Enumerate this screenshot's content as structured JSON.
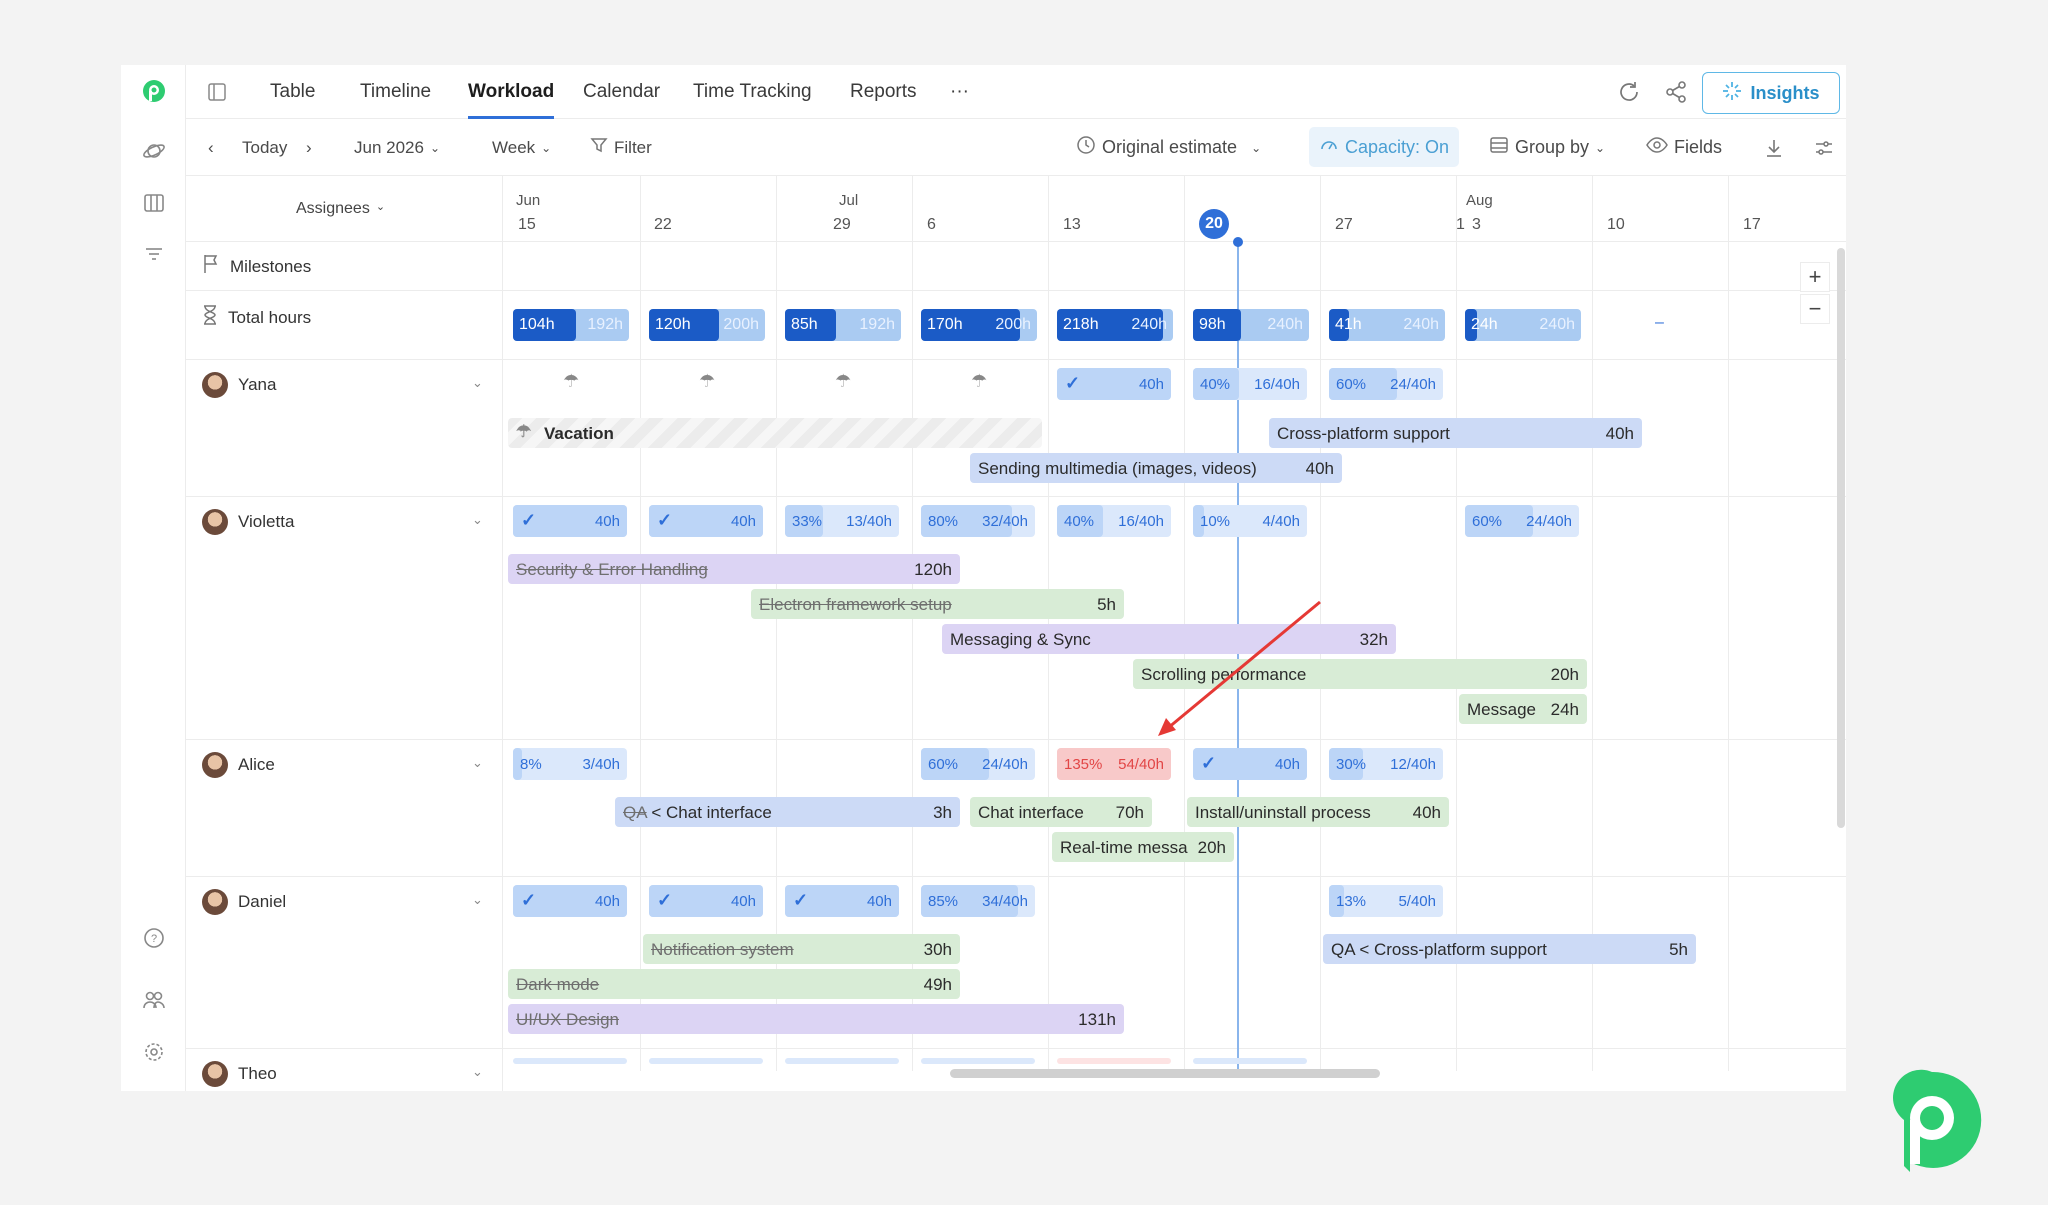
{
  "nav": {
    "tabs": [
      "Table",
      "Timeline",
      "Workload",
      "Calendar",
      "Time Tracking",
      "Reports",
      "···"
    ],
    "insights_label": "Insights"
  },
  "toolbar": {
    "today": "Today",
    "month": "Jun 2026",
    "period": "Week",
    "filter": "Filter",
    "estimate": "Original estimate",
    "capacity": "Capacity: On",
    "group_by": "Group by",
    "fields": "Fields"
  },
  "timeline": {
    "assignees_label": "Assignees",
    "months": [
      "Jun",
      "Jul",
      "Aug"
    ],
    "days": [
      "15",
      "22",
      "29",
      "6",
      "13",
      "20",
      "27",
      "1",
      "3",
      "10",
      "17"
    ],
    "today_day": "20"
  },
  "rows": {
    "milestones": "Milestones",
    "total_hours": "Total hours",
    "people": [
      "Yana",
      "Violetta",
      "Alice",
      "Daniel",
      "Theo"
    ]
  },
  "total_hours": [
    {
      "used": "104h",
      "cap": "192h"
    },
    {
      "used": "120h",
      "cap": "200h"
    },
    {
      "used": "85h",
      "cap": "192h"
    },
    {
      "used": "170h",
      "cap": "200h"
    },
    {
      "used": "218h",
      "cap": "240h"
    },
    {
      "used": "98h",
      "cap": "240h"
    },
    {
      "used": "41h",
      "cap": "240h"
    },
    {
      "used": "24h",
      "cap": "240h"
    },
    {
      "used": "–"
    }
  ],
  "capacity_cells": {
    "yana": [
      {
        "h": "40h"
      },
      {
        "p": "40%",
        "h": "16/40h"
      },
      {
        "p": "60%",
        "h": "24/40h"
      }
    ],
    "violetta": [
      {
        "h": "40h"
      },
      {
        "h": "40h"
      },
      {
        "p": "33%",
        "h": "13/40h"
      },
      {
        "p": "80%",
        "h": "32/40h"
      },
      {
        "p": "40%",
        "h": "16/40h"
      },
      {
        "p": "10%",
        "h": "4/40h"
      },
      {
        "p": "60%",
        "h": "24/40h"
      }
    ],
    "alice": [
      {
        "p": "8%",
        "h": "3/40h"
      },
      {
        "p": "60%",
        "h": "24/40h"
      },
      {
        "p": "135%",
        "h": "54/40h"
      },
      {
        "h": "40h"
      },
      {
        "p": "30%",
        "h": "12/40h"
      }
    ],
    "daniel": [
      {
        "h": "40h"
      },
      {
        "h": "40h"
      },
      {
        "h": "40h"
      },
      {
        "p": "85%",
        "h": "34/40h"
      },
      {
        "p": "13%",
        "h": "5/40h"
      }
    ]
  },
  "tasks": {
    "yana": [
      {
        "name": "Vacation",
        "hours": ""
      },
      {
        "name": "Cross-platform support",
        "hours": "40h"
      },
      {
        "name": "Sending multimedia (images, videos)",
        "hours": "40h"
      }
    ],
    "violetta": [
      {
        "name": "Security & Error Handling",
        "hours": "120h"
      },
      {
        "name": "Electron framework setup",
        "hours": "5h"
      },
      {
        "name": "Messaging & Sync",
        "hours": "32h"
      },
      {
        "name": "Scrolling performance",
        "hours": "20h"
      },
      {
        "name": "Message",
        "hours": "24h"
      }
    ],
    "alice": [
      {
        "prefix": "QA",
        "name": "< Chat interface",
        "hours": "3h"
      },
      {
        "name": "Chat interface",
        "hours": "70h"
      },
      {
        "name": "Install/uninstall process",
        "hours": "40h"
      },
      {
        "name": "Real-time messa",
        "hours": "20h"
      }
    ],
    "daniel": [
      {
        "name": "Notification system",
        "hours": "30h"
      },
      {
        "name": "QA < Cross-platform support",
        "hours": "5h"
      },
      {
        "name": "Dark mode",
        "hours": "49h"
      },
      {
        "name": "UI/UX Design",
        "hours": "131h"
      }
    ]
  },
  "colors": {
    "accent": "#2f6fd8",
    "brand": "#2ecc71",
    "over": "#e24646",
    "annotation_arrow": "#e53935"
  }
}
